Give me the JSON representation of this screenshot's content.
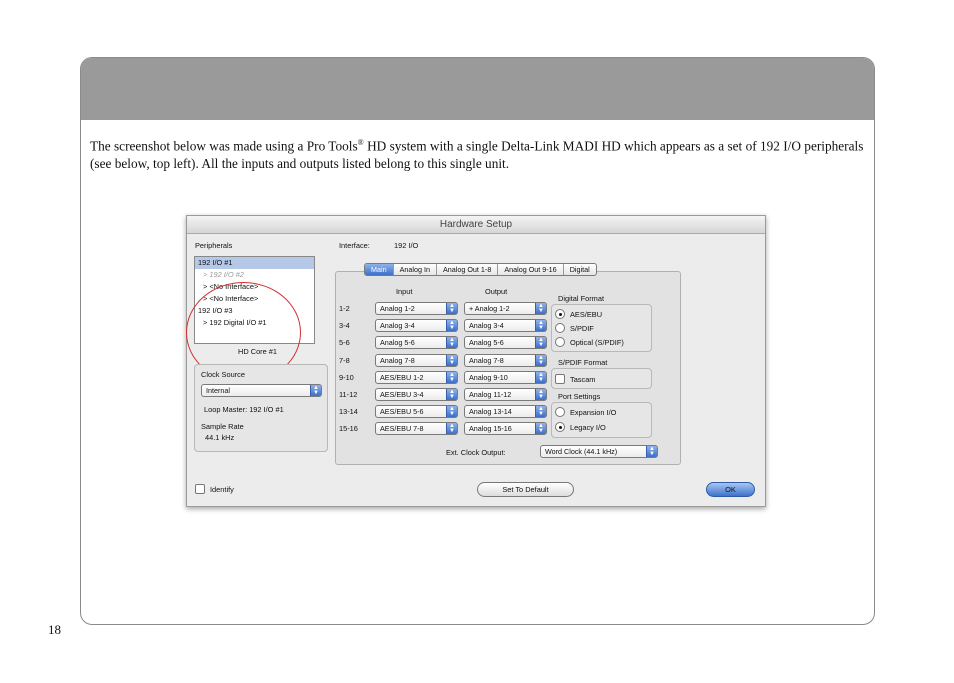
{
  "intro": {
    "text_part1": "The screenshot below was made using a Pro Tools",
    "reg": "®",
    "text_part2": " HD system with a single Delta-Link MADI HD which appears as a set of 192 I/O peripherals (see below, top left). All the inputs and outputs listed belong to this single unit."
  },
  "page_number": "18",
  "window": {
    "title": "Hardware Setup",
    "peripherals_label": "Peripherals",
    "peripherals": [
      {
        "label": "192 I/O #1",
        "selected": true
      },
      {
        "label": "> 192 I/O #2",
        "dimmed": true
      },
      {
        "label": "> <No Interface>"
      },
      {
        "label": "> <No Interface>"
      },
      {
        "label": "192 I/O #3"
      },
      {
        "label": "> 192 Digital I/O #1"
      }
    ],
    "hd_core": "HD Core #1",
    "interface_label": "Interface:",
    "interface_value": "192 I/O",
    "clock_source_label": "Clock Source",
    "clock_source_value": "Internal",
    "loop_master": "Loop Master: 192 I/O #1",
    "sample_rate_label": "Sample Rate",
    "sample_rate_value": "44.1 kHz",
    "tabs": [
      "Main",
      "Analog In",
      "Analog Out 1-8",
      "Analog Out 9-16",
      "Digital"
    ],
    "input_header": "Input",
    "output_header": "Output",
    "channels": [
      {
        "ch": "1-2",
        "input": "Analog 1-2",
        "output": "+ Analog 1-2"
      },
      {
        "ch": "3-4",
        "input": "Analog 3-4",
        "output": "Analog 3-4"
      },
      {
        "ch": "5-6",
        "input": "Analog 5-6",
        "output": "Analog 5-6"
      },
      {
        "ch": "7-8",
        "input": "Analog 7-8",
        "output": "Analog 7-8"
      },
      {
        "ch": "9-10",
        "input": "AES/EBU 1-2",
        "output": "Analog 9-10"
      },
      {
        "ch": "11-12",
        "input": "AES/EBU 3-4",
        "output": "Analog 11-12"
      },
      {
        "ch": "13-14",
        "input": "AES/EBU 5-6",
        "output": "Analog 13-14"
      },
      {
        "ch": "15-16",
        "input": "AES/EBU 7-8",
        "output": "Analog 15-16"
      }
    ],
    "digital_format_label": "Digital Format",
    "digital_format_options": [
      "AES/EBU",
      "S/PDIF",
      "Optical (S/PDIF)"
    ],
    "spdif_format_label": "S/PDIF Format",
    "tascam_label": "Tascam",
    "port_settings_label": "Port Settings",
    "port_settings_options": [
      "Expansion I/O",
      "Legacy I/O"
    ],
    "ext_clock_label": "Ext. Clock Output:",
    "ext_clock_value": "Word Clock (44.1 kHz)",
    "identify_label": "Identify",
    "set_default_label": "Set To Default",
    "ok_label": "OK"
  }
}
